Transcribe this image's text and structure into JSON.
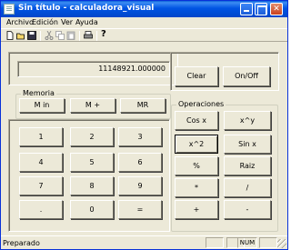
{
  "window": {
    "title": "Sin título - calculadora_visual"
  },
  "menu": {
    "items": [
      "Archivo",
      "Edición",
      "Ver",
      "Ayuda"
    ]
  },
  "toolbar": {
    "icons": [
      "new-file-icon",
      "open-folder-icon",
      "save-icon",
      "cut-icon",
      "copy-icon",
      "paste-icon",
      "print-icon",
      "help-icon"
    ],
    "help_glyph": "?"
  },
  "display": {
    "value": "11148921.000000"
  },
  "controls": {
    "clear_label": "Clear",
    "onoff_label": "On/Off"
  },
  "memoria": {
    "label": "Memoria",
    "buttons": [
      "M in",
      "M +",
      "MR"
    ]
  },
  "keypad": {
    "keys": [
      "1",
      "2",
      "3",
      "4",
      "5",
      "6",
      "7",
      "8",
      "9",
      ".",
      "0",
      "="
    ]
  },
  "operaciones": {
    "label": "Operaciones",
    "buttons": [
      "Cos x",
      "x^y",
      "x^2",
      "Sin x",
      "%",
      "Raiz",
      "*",
      "/",
      "+",
      "-"
    ],
    "active_button": "x^2"
  },
  "status": {
    "text": "Preparado",
    "num": "NUM"
  }
}
